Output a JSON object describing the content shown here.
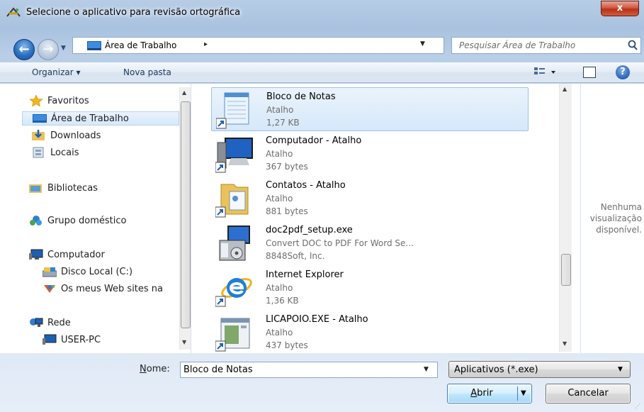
{
  "window": {
    "title": "Selecione o aplicativo para revisão ortográfica",
    "close_label": "x"
  },
  "nav": {
    "back_label": "←",
    "forward_label": "→",
    "address_path": "Área de Trabalho",
    "address_sep": "▸",
    "search_placeholder": "Pesquisar Área de Trabalho"
  },
  "toolbar": {
    "organize_label": "Organizar ▾",
    "new_folder_label": "Nova pasta",
    "help_label": "?"
  },
  "sidebar": {
    "favorites": "Favoritos",
    "desktop": "Área de Trabalho",
    "downloads": "Downloads",
    "places": "Locais",
    "libraries": "Bibliotecas",
    "homegroup": "Grupo doméstico",
    "computer": "Computador",
    "local_disk": "Disco Local (C:)",
    "web_sites": "Os meus Web sites na",
    "network": "Rede",
    "user_pc": "USER-PC"
  },
  "files": [
    {
      "name": "Bloco de Notas",
      "type": "Atalho",
      "size": "1,27 KB"
    },
    {
      "name": "Computador - Atalho",
      "type": "Atalho",
      "size": "367 bytes"
    },
    {
      "name": "Contatos - Atalho",
      "type": "Atalho",
      "size": "881 bytes"
    },
    {
      "name": "doc2pdf_setup.exe",
      "type": "Convert DOC to PDF For Word Se...",
      "size": "8848Soft, Inc."
    },
    {
      "name": "Internet Explorer",
      "type": "Atalho",
      "size": "1,36 KB"
    },
    {
      "name": "LICAPOIO.EXE - Atalho",
      "type": "Atalho",
      "size": "437 bytes"
    }
  ],
  "preview": {
    "line1": "Nenhuma",
    "line2": "visualização",
    "line3": "disponível."
  },
  "bottom": {
    "name_label_u": "N",
    "name_label_rest": "ome:",
    "name_value": "Bloco de Notas",
    "filter_value": "Aplicativos (*.exe)",
    "open_u": "A",
    "open_rest": "brir",
    "cancel_label": "Cancelar"
  },
  "colors": {
    "selection": "#d6e8f9",
    "accent_blue": "#2a6fc1",
    "close_red": "#c7402a"
  }
}
